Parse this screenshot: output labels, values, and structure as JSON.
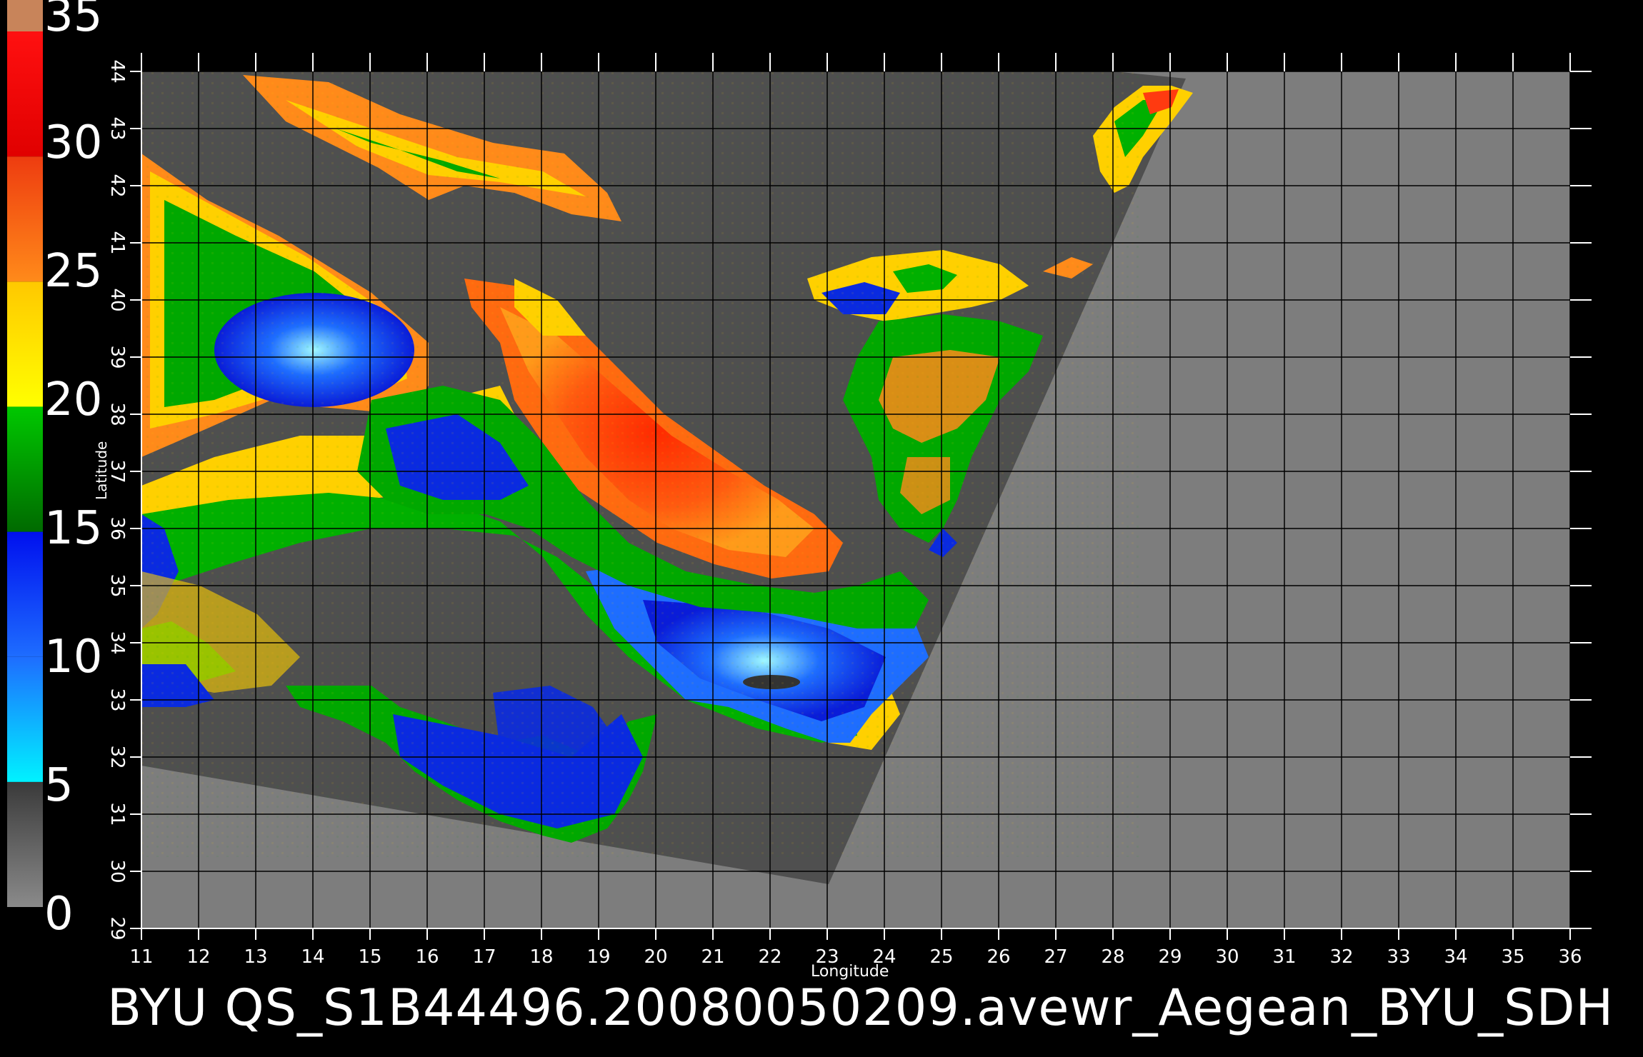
{
  "colorbar": {
    "labels": [
      "35",
      "30",
      "25",
      "20",
      "15",
      "10",
      "5",
      "0"
    ],
    "bands": [
      {
        "from": 0,
        "to": 5,
        "color_top": "#3a3a3a",
        "color_bottom": "#8a8a8a"
      },
      {
        "from": 5,
        "to": 10,
        "color_top": "#1e6dff",
        "color_bottom": "#00f2ff"
      },
      {
        "from": 10,
        "to": 15,
        "color_top": "#0010ee",
        "color_bottom": "#1e6dff"
      },
      {
        "from": 15,
        "to": 20,
        "color_top": "#00c800",
        "color_bottom": "#006a00"
      },
      {
        "from": 20,
        "to": 25,
        "color_top": "#ffc800",
        "color_bottom": "#ffff00"
      },
      {
        "from": 25,
        "to": 30,
        "color_top": "#ee3c10",
        "color_bottom": "#ff8a1a"
      },
      {
        "from": 30,
        "to": 35,
        "color_top": "#ff1010",
        "color_bottom": "#e00000"
      }
    ],
    "cap_color": "#c8845a"
  },
  "map": {
    "lon_ticks": [
      "11",
      "12",
      "13",
      "14",
      "15",
      "16",
      "17",
      "18",
      "19",
      "20",
      "21",
      "22",
      "23",
      "24",
      "25",
      "26",
      "27",
      "28",
      "29",
      "30",
      "31",
      "32",
      "33",
      "34",
      "35",
      "36"
    ],
    "lat_ticks": [
      "29",
      "30",
      "31",
      "32",
      "33",
      "34",
      "35",
      "36",
      "37",
      "38",
      "39",
      "40",
      "41",
      "42",
      "43",
      "44"
    ],
    "xlabel": "Longitude",
    "ylabel": "Latitude",
    "colors": {
      "outside_swath": "#7d7d7d",
      "land": "#4f4f4f",
      "grid": "#000000"
    }
  },
  "footer": {
    "title": "BYU  QS_S1B44496.20080050209.avewr_Aegean_BYU_SDH"
  }
}
